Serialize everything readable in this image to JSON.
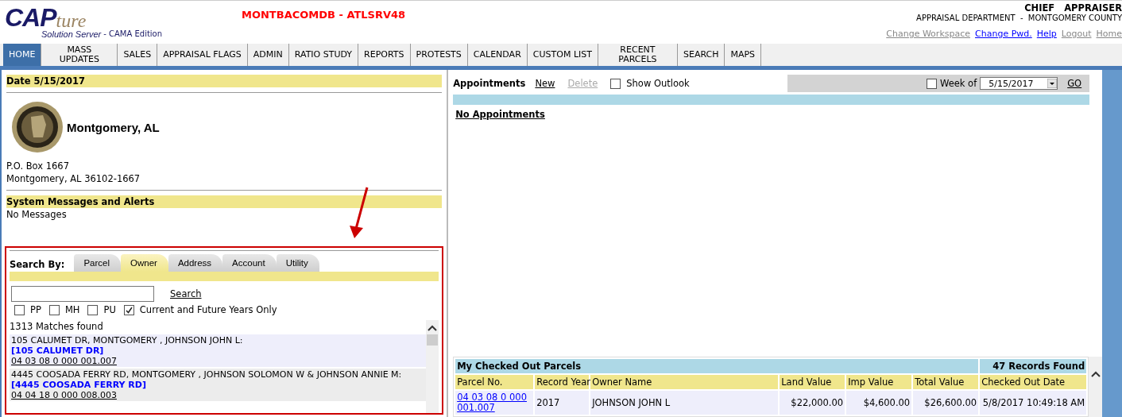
{
  "header": {
    "logo_word": "CAP",
    "logo_script": "ture",
    "logo_tagline": "Solution Server",
    "logo_edition": "- CAMA Edition",
    "db_title": "MONTBACOMDB - ATLSRV48",
    "user_title": "CHIEF   APPRAISER",
    "department": "APPRAISAL DEPARTMENT  -  MONTGOMERY COUNTY",
    "links": [
      {
        "label": "Change Workspace",
        "disabled": true
      },
      {
        "label": "Change Pwd.",
        "disabled": false
      },
      {
        "label": "Help",
        "disabled": false
      },
      {
        "label": "Logout",
        "disabled": true
      },
      {
        "label": "Home",
        "disabled": true
      }
    ]
  },
  "nav_tabs": [
    {
      "label": "HOME",
      "selected": true
    },
    {
      "label": "MASS UPDATES",
      "selected": false
    },
    {
      "label": "SALES",
      "selected": false
    },
    {
      "label": "APPRAISAL FLAGS",
      "selected": false
    },
    {
      "label": "ADMIN",
      "selected": false
    },
    {
      "label": "RATIO STUDY",
      "selected": false
    },
    {
      "label": "REPORTS",
      "selected": false
    },
    {
      "label": "PROTESTS",
      "selected": false
    },
    {
      "label": "CALENDAR",
      "selected": false
    },
    {
      "label": "CUSTOM LIST",
      "selected": false
    },
    {
      "label": "RECENT PARCELS",
      "selected": false
    },
    {
      "label": "SEARCH",
      "selected": false
    },
    {
      "label": "MAPS",
      "selected": false
    }
  ],
  "left": {
    "date_header": "Date 5/15/2017",
    "county_name": "Montgomery, AL",
    "address": [
      "P.O. Box 1667",
      "Montgomery, AL 36102-1667"
    ],
    "messages_header": "System Messages and Alerts",
    "messages": "No Messages"
  },
  "search": {
    "label": "Search By:",
    "tabs": [
      {
        "label": "Parcel",
        "selected": false
      },
      {
        "label": "Owner",
        "selected": true
      },
      {
        "label": "Address",
        "selected": false
      },
      {
        "label": "Account",
        "selected": false
      },
      {
        "label": "Utility",
        "selected": false
      }
    ],
    "search_link": "Search",
    "options": [
      {
        "label": "PP",
        "checked": false
      },
      {
        "label": "MH",
        "checked": false
      },
      {
        "label": "PU",
        "checked": false
      },
      {
        "label": "Current and Future Years Only",
        "checked": true
      }
    ],
    "matches": "1313 Matches found",
    "results": [
      {
        "line": "105 CALUMET DR,  MONTGOMERY , JOHNSON JOHN L:",
        "address": "[105 CALUMET DR]",
        "parcel": "04 03 08 0 000 001.007"
      },
      {
        "line": "4445 COOSADA FERRY RD,  MONTGOMERY , JOHNSON SOLOMON W & JOHNSON ANNIE M:",
        "address": "[4445 COOSADA FERRY RD]",
        "parcel": "04 04 18 0 000 008.003"
      }
    ]
  },
  "appointments": {
    "title": "Appointments",
    "actions": [
      {
        "label": "New",
        "disabled": false
      },
      {
        "label": "Delete",
        "disabled": true
      }
    ],
    "show_outlook": {
      "label": "Show Outlook",
      "checked": false
    },
    "week_of": {
      "label": "Week of",
      "checked": false,
      "value": "5/15/2017"
    },
    "go": "GO",
    "empty": "No Appointments"
  },
  "checked_out": {
    "title": "My Checked Out Parcels",
    "count": "47 Records Found",
    "columns": [
      "Parcel No.",
      "Record Year",
      "Owner Name",
      "Land Value",
      "Imp Value",
      "Total Value",
      "Checked Out Date"
    ],
    "rows": [
      [
        "04 03 08 0 000 001.007",
        "2017",
        "JOHNSON JOHN L",
        "$22,000.00",
        "$4,600.00",
        "$26,600.00",
        "5/8/2017 10:49:18 AM"
      ]
    ]
  }
}
